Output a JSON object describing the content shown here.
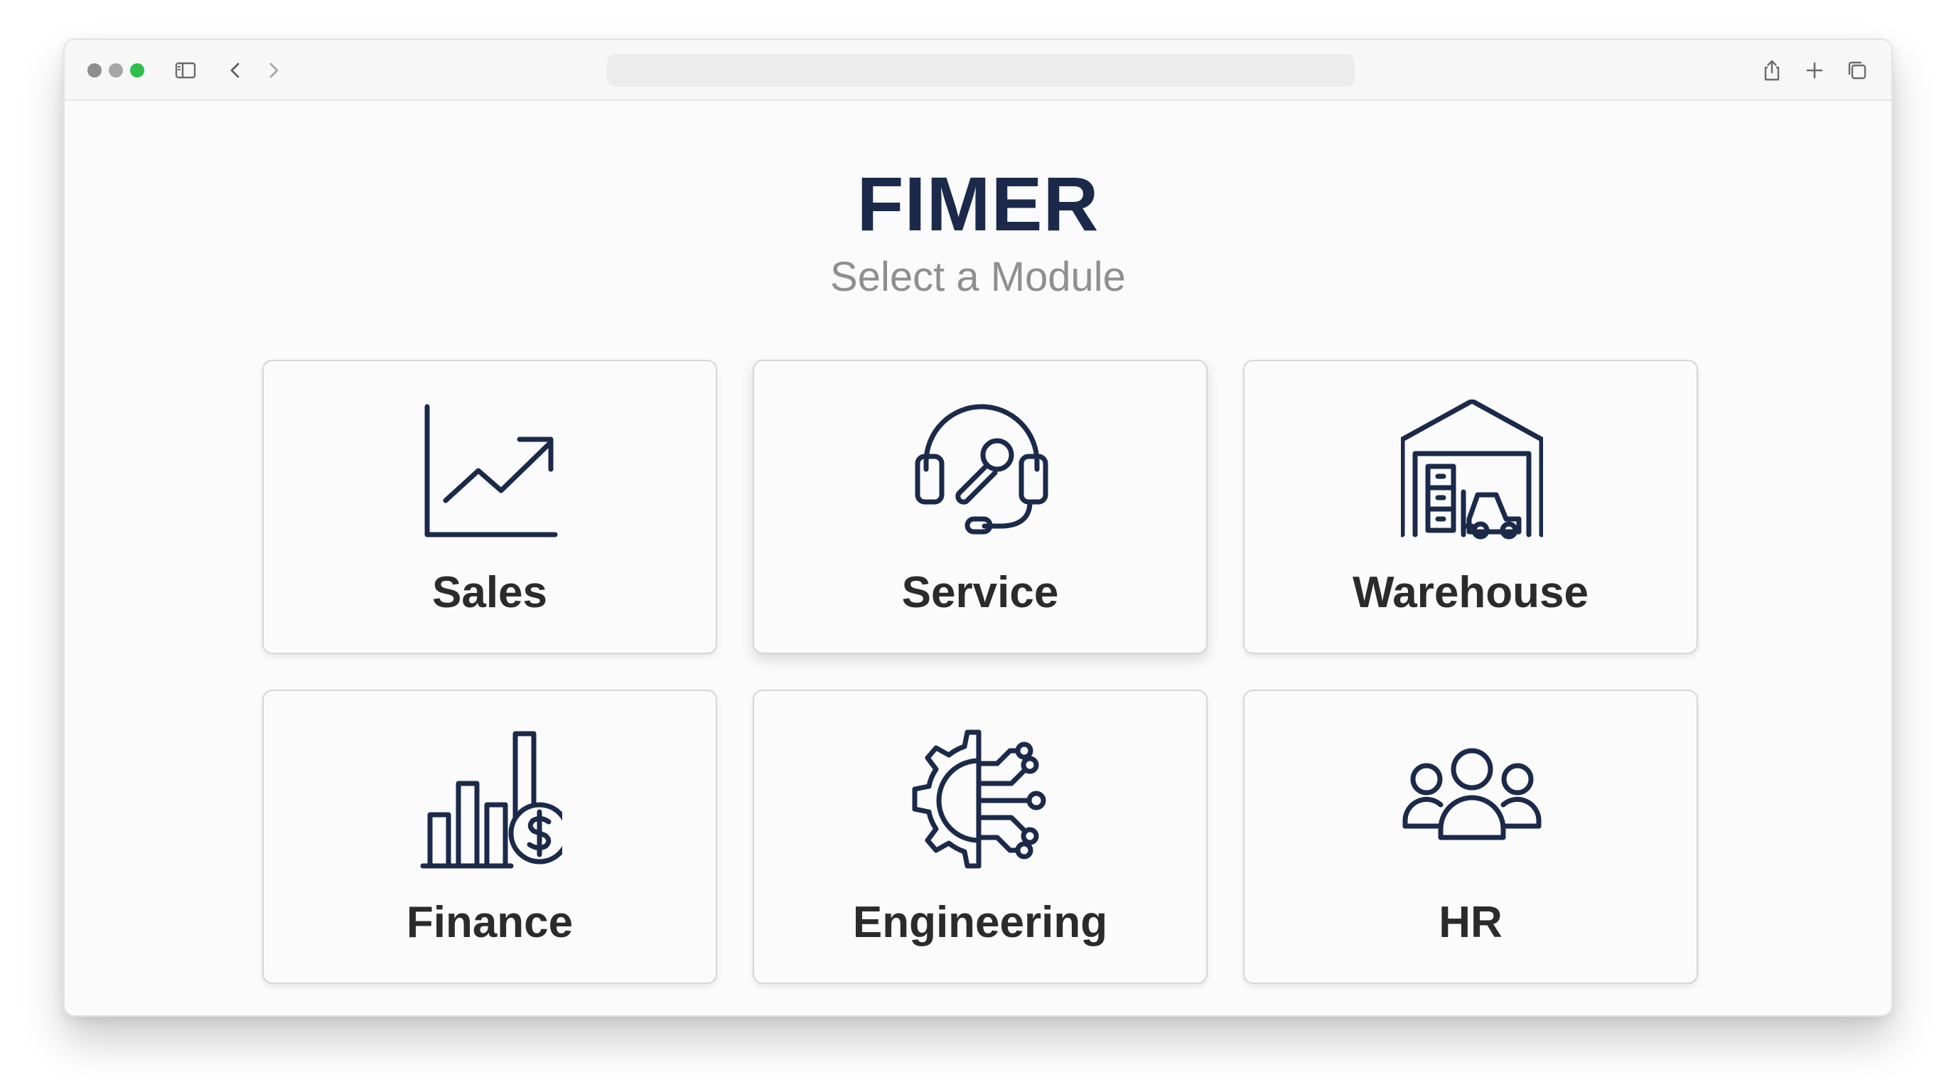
{
  "browser": {
    "address": "",
    "traffic_lights": [
      "#8e8e8e",
      "#a6a6a6",
      "#2fbf4a"
    ]
  },
  "page": {
    "title": "FIMER",
    "subtitle": "Select a Module"
  },
  "modules": [
    {
      "label": "Sales",
      "icon": "trend-chart-icon"
    },
    {
      "label": "Service",
      "icon": "headset-wrench-icon"
    },
    {
      "label": "Warehouse",
      "icon": "warehouse-forklift-icon"
    },
    {
      "label": "Finance",
      "icon": "bar-chart-dollar-icon"
    },
    {
      "label": "Engineering",
      "icon": "gear-circuit-icon"
    },
    {
      "label": "HR",
      "icon": "people-group-icon"
    }
  ],
  "colors": {
    "title": "#1b2a4a",
    "icon_stroke": "#1b2a4a",
    "subtitle": "#8f8f8f",
    "label": "#2b2b2b"
  }
}
